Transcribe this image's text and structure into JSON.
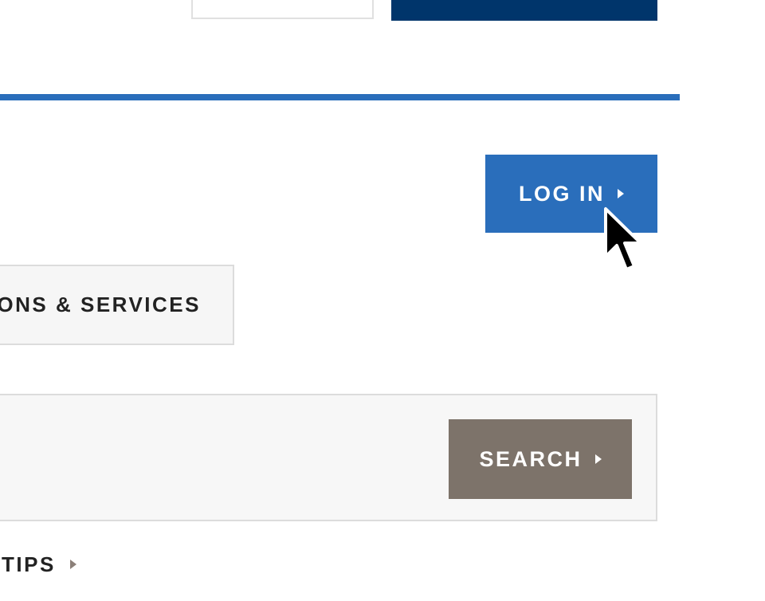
{
  "header": {
    "login_label": "LOG IN"
  },
  "tabs": {
    "services_label": "ONS & SERVICES"
  },
  "search": {
    "button_label": "SEARCH"
  },
  "footer": {
    "tips_label": "TIPS"
  },
  "colors": {
    "brand_blue": "#2a6ebb",
    "navy": "#00356b",
    "search_brown": "#7d736a"
  }
}
